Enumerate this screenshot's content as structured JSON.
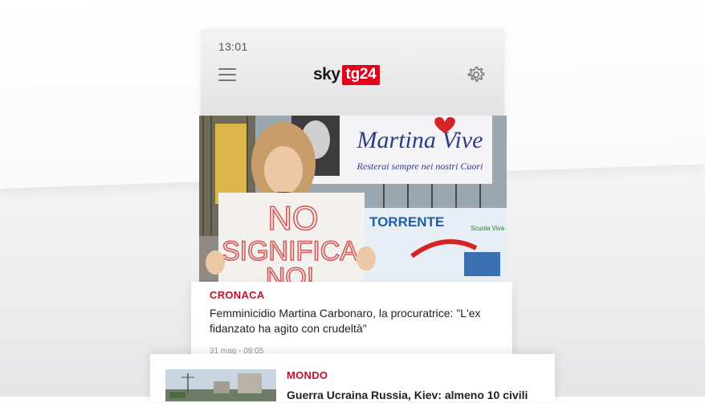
{
  "status_bar": {
    "time": "13:01"
  },
  "header": {
    "logo_sky": "sky",
    "logo_tg": "tg24",
    "menu_icon": "hamburger-menu-icon",
    "settings_icon": "gear-icon"
  },
  "articles": [
    {
      "category": "CRONACA",
      "headline_line1": "Femminicidio Martina Carbonaro, la procuratrice: \"L'ex",
      "headline_line2": "fidanzato ha agito con crudeltà\"",
      "date": "31 mag - 09:05",
      "image": {
        "banner_title": "Martina Vive",
        "banner_subtitle": "Resterai sempre nei nostri Cuori",
        "sign_line1": "NO",
        "sign_line2": "SIGNIFICA",
        "sign_line3": "NO!",
        "poster_title": "TORRENTE",
        "poster_label": "Scuola Viva"
      }
    },
    {
      "category": "MONDO",
      "headline": "Guerra Ucraina Russia, Kiev: almeno 10 civili"
    }
  ],
  "colors": {
    "brand_red": "#e2001a",
    "category_red": "#c8102e"
  }
}
